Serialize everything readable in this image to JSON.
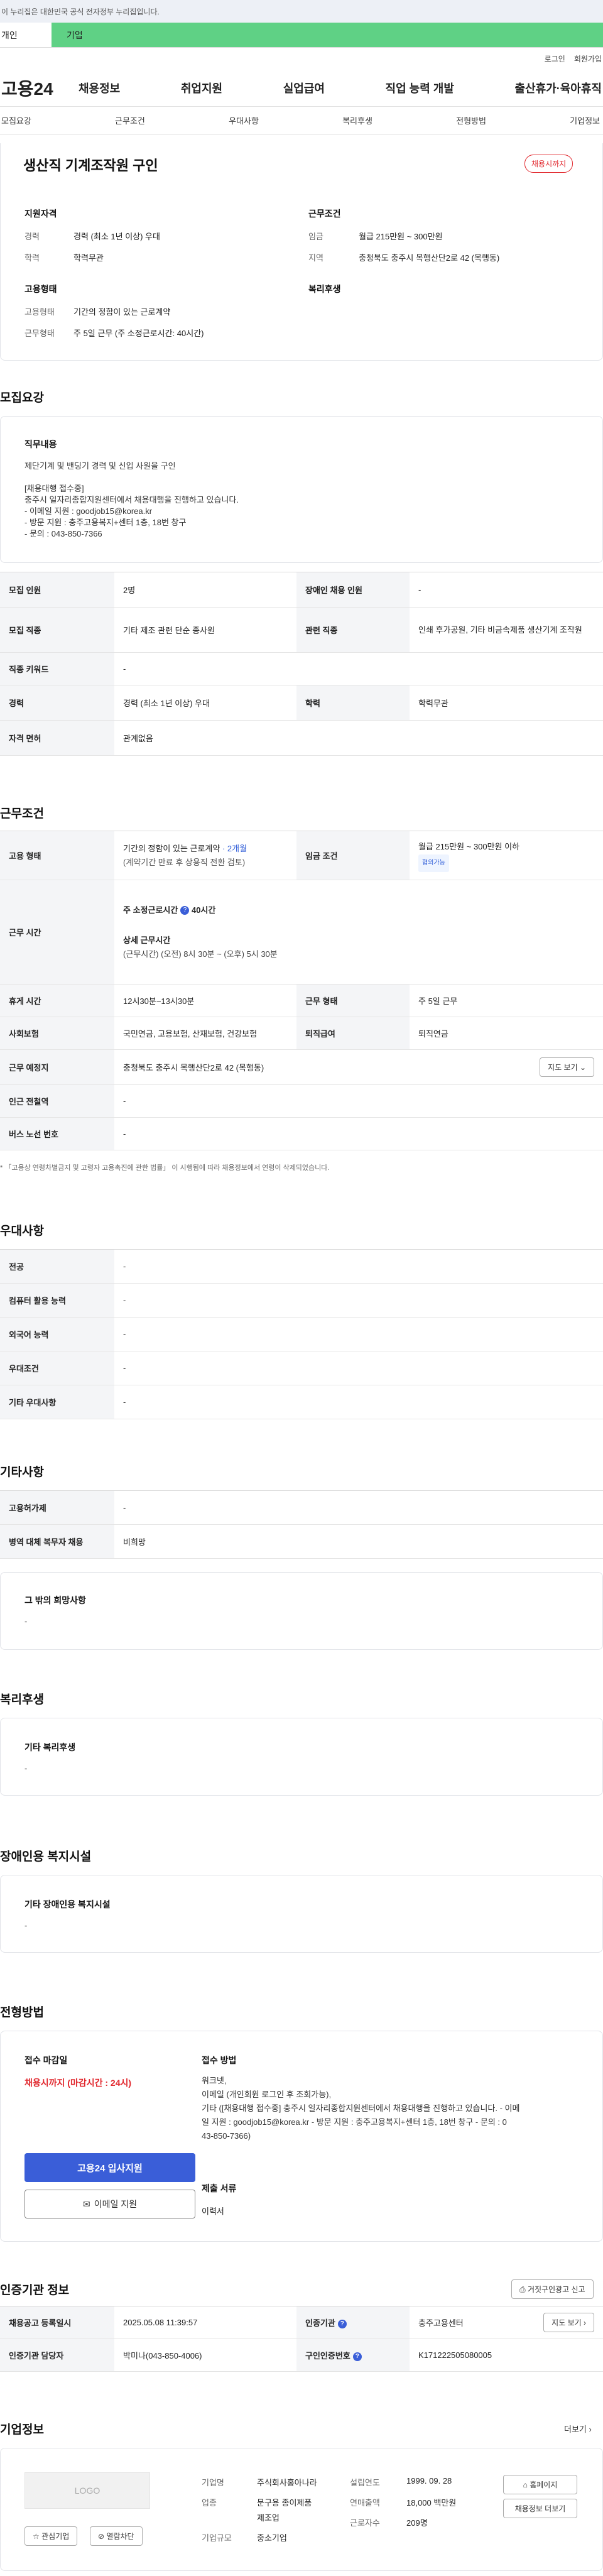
{
  "banner": {
    "text": "이 누리집은 대한민국 공식 전자정부 누리집입니다."
  },
  "tabs": {
    "individual": "개인",
    "corporate": "기업"
  },
  "util": {
    "login": "로그인",
    "join": "회원가입"
  },
  "gnb": {
    "logo": "고용24",
    "items": [
      "채용정보",
      "취업지원",
      "실업급여",
      "직업 능력 개발",
      "출산휴가·육아휴직"
    ]
  },
  "anchors": [
    "모집요강",
    "근무조건",
    "우대사항",
    "복리후생",
    "전형방법",
    "기업정보"
  ],
  "summary": {
    "title": "생산직 기계조작원 구인",
    "status": "채용시까지",
    "qual_title": "지원자격",
    "cond_title": "근무조건",
    "emp_title": "고용형태",
    "welfare_title": "복리후생",
    "rows_left": [
      {
        "k": "경력",
        "v": "경력 (최소 1년 이상) 우대"
      },
      {
        "k": "학력",
        "v": "학력무관"
      }
    ],
    "rows_right": [
      {
        "k": "임금",
        "v": "월급 215만원 ~ 300만원"
      },
      {
        "k": "지역",
        "v": "충청북도 충주시 목행산단2로 42 (목행동)"
      }
    ],
    "rows_emp": [
      {
        "k": "고용형태",
        "v": "기간의 정함이 있는 근로계약"
      },
      {
        "k": "근무형태",
        "v": "주 5일 근무 (주 소정근로시간: 40시간)"
      }
    ]
  },
  "recruit": {
    "title": "모집요강",
    "duty_title": "직무내용",
    "duty_lines": [
      "제단기계 및 밴딩기 경력 및 신입 사원을 구인",
      "[채용대행 접수중]",
      "충주시 일자리종합지원센터에서 채용대행을 진행하고 있습니다.",
      "- 이메일 지원 : goodjob15@korea.kr",
      "- 방문 지원 : 충주고용복지+센터 1층, 18번 창구",
      "- 문의 : 043-850-7366"
    ],
    "headcount_k": "모집 인원",
    "headcount_v": "2명",
    "disabled_k": "장애인 채용 인원",
    "disabled_v": "-",
    "job_k": "모집 직종",
    "job_v": "기타 제조 관련 단순 종사원",
    "related_k": "관련 직종",
    "related_v": "인쇄 후가공원, 기타 비금속제품 생산기계 조작원",
    "keyword_k": "직종 키워드",
    "keyword_v": "-",
    "career_k": "경력",
    "career_v": "경력 (최소 1년 이상) 우대",
    "edu_k": "학력",
    "edu_v": "학력무관",
    "license_k": "자격 면허",
    "license_v": "관계없음"
  },
  "work": {
    "title": "근무조건",
    "emp_k": "고용 형태",
    "emp_v": "기간의 정함이 있는 근로계약",
    "emp_period": "· 2개월",
    "emp_note": "(계약기간 만료 후 상용직 전환 검토)",
    "wage_k": "임금 조건",
    "wage_v": "월급 215만원 ~ 300만원 이하",
    "wage_badge": "협의가능",
    "hours_k": "근무 시간",
    "hours_label": "주 소정근로시간",
    "hours_value": "40시간",
    "detail_label": "상세 근무시간",
    "detail_value": "(근무시간) (오전) 8시 30분 ~ (오후) 5시 30분",
    "break_k": "휴게 시간",
    "break_v": "12시30분~13시30분",
    "form_k": "근무 형태",
    "form_v": "주 5일 근무",
    "ins_k": "사회보험",
    "ins_v": "국민연금, 고용보험, 산재보험, 건강보험",
    "retire_k": "퇴직급여",
    "retire_v": "퇴직연금",
    "place_k": "근무 예정지",
    "place_v": "충청북도 충주시 목행산단2로 42 (목행동)",
    "map_btn": "지도 보기",
    "subway_k": "인근 전철역",
    "subway_v": "-",
    "bus_k": "버스 노선 번호",
    "bus_v": "-",
    "note": "* 「고용상 연령차별금지 및 고령자 고용촉진에 관한 법률」 이 시행됨에 따라 채용정보에서 연령이 삭제되었습니다."
  },
  "pref": {
    "title": "우대사항",
    "rows": [
      {
        "k": "전공",
        "v": "-"
      },
      {
        "k": "컴퓨터 활용 능력",
        "v": "-"
      },
      {
        "k": "외국어 능력",
        "v": "-"
      },
      {
        "k": "우대조건",
        "v": "-"
      },
      {
        "k": "기타 우대사항",
        "v": "-"
      }
    ]
  },
  "etc": {
    "title": "기타사항",
    "rows": [
      {
        "k": "고용허가제",
        "v": "-"
      },
      {
        "k": "병역 대체 복무자 채용",
        "v": "비희망"
      }
    ],
    "hope_title": "그 밖의 희망사항",
    "hope_v": "-"
  },
  "welfare": {
    "title": "복리후생",
    "box_title": "기타 복리후생",
    "box_v": "-"
  },
  "disabled_fac": {
    "title": "장애인용 복지시설",
    "box_title": "기타 장애인용 복지시설",
    "box_v": "-"
  },
  "process": {
    "title": "전형방법",
    "deadline_title": "접수 마감일",
    "deadline_v": "채용시까지 (마감시간 : 24시)",
    "method_title": "접수 방법",
    "method_lines": [
      "워크넷,",
      "이메일 (개인회원 로그인 후 조회가능),",
      "기타 ([채용대행 접수중] 충주시 일자리종합지원센터에서 채용대행을 진행하고 있습니다. - 이메",
      "일 지원 : goodjob15@korea.kr - 방문 지원 : 충주고용복지+센터 1층, 18번 창구 - 문의 : 0",
      "43-850-7366)"
    ],
    "docs_title": "제출 서류",
    "docs_v": "이력서",
    "apply_btn": "고용24 입사지원",
    "email_btn": "이메일 지원"
  },
  "cert": {
    "title": "인증기관 정보",
    "report_btn": "거짓구인광고 신고",
    "reg_k": "채용공고 등록일시",
    "reg_v": "2025.05.08 11:39:57",
    "org_k": "인증기관",
    "org_v": "충주고용센터",
    "map_btn": "지도 보기",
    "mgr_k": "인증기관 담당자",
    "mgr_v": "박미나(043-850-4006)",
    "no_k": "구인인증번호",
    "no_v": "K171222505080005"
  },
  "company": {
    "title": "기업정보",
    "more": "더보기",
    "logo_text": "LOGO",
    "fav_btn": "관심기업",
    "block_btn": "열람차단",
    "name_k": "기업명",
    "name_v": "주식회사홍아나라",
    "ind_k": "업종",
    "ind_v1": "문구용 종이제품",
    "ind_v2": "제조업",
    "size_k": "기업규모",
    "size_v": "중소기업",
    "est_k": "설립연도",
    "est_v": "1999. 09. 28",
    "sales_k": "연매출액",
    "sales_v": "18,000 백만원",
    "emp_k": "근로자수",
    "emp_v": "209명",
    "home_btn": "홈페이지",
    "jobs_btn": "채용정보 더보기"
  }
}
